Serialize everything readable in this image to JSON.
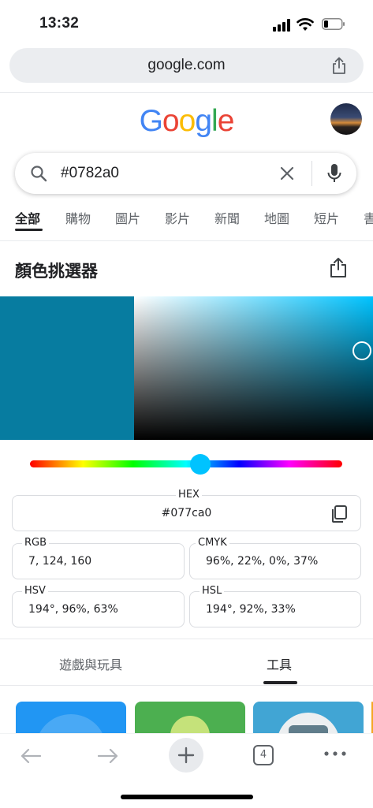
{
  "status_bar": {
    "time": "13:32"
  },
  "browser": {
    "url": "google.com",
    "open_tabs": "4"
  },
  "google": {
    "logo_letters": [
      {
        "char": "G",
        "color": "#4285F4"
      },
      {
        "char": "o",
        "color": "#EA4335"
      },
      {
        "char": "o",
        "color": "#FBBC05"
      },
      {
        "char": "g",
        "color": "#4285F4"
      },
      {
        "char": "l",
        "color": "#34A853"
      },
      {
        "char": "e",
        "color": "#EA4335"
      }
    ]
  },
  "search": {
    "query": "#0782a0"
  },
  "tabs": [
    {
      "label": "全部",
      "active": true
    },
    {
      "label": "購物"
    },
    {
      "label": "圖片"
    },
    {
      "label": "影片"
    },
    {
      "label": "新聞"
    },
    {
      "label": "地圖"
    },
    {
      "label": "短片"
    },
    {
      "label": "書"
    }
  ],
  "color_picker": {
    "title": "顏色挑選器",
    "selected_color": "#077ca0",
    "hue_color": "#00c3ff",
    "hex": {
      "label": "HEX",
      "value": "#077ca0"
    },
    "rgb": {
      "label": "RGB",
      "value": "7, 124, 160"
    },
    "cmyk": {
      "label": "CMYK",
      "value": "96%, 22%, 0%, 37%"
    },
    "hsv": {
      "label": "HSV",
      "value": "194°, 96%, 63%"
    },
    "hsl": {
      "label": "HSL",
      "value": "194°, 92%, 33%"
    }
  },
  "bottom_tabs": [
    {
      "label": "遊戲與玩具"
    },
    {
      "label": "工具",
      "active": true
    }
  ]
}
